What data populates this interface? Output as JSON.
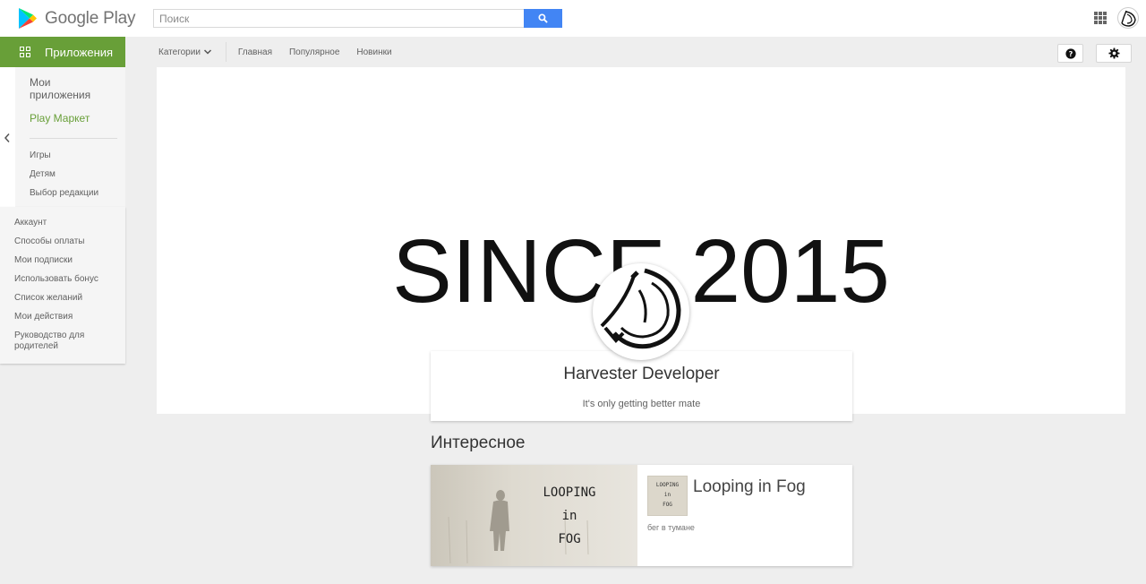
{
  "header": {
    "logo_text": "Google Play",
    "search_placeholder": "Поиск"
  },
  "subnav": {
    "apps_tab": "Приложения",
    "categories": "Категории",
    "links": [
      "Главная",
      "Популярное",
      "Новинки"
    ]
  },
  "sidebar": {
    "my_apps": "Мои приложения",
    "play_market": "Play Маркет",
    "sub_items": [
      "Игры",
      "Детям",
      "Выбор редакции"
    ],
    "account_links": [
      "Аккаунт",
      "Способы оплаты",
      "Мои подписки",
      "Использовать бонус",
      "Список желаний",
      "Мои действия",
      "Руководство для родителей"
    ]
  },
  "banner": {
    "title": "SINCE 2015"
  },
  "developer": {
    "name": "Harvester Developer",
    "tagline": "It's only getting better mate"
  },
  "featured": {
    "section_title": "Интересное",
    "image_text": [
      "LOOPING",
      "in",
      "FOG"
    ],
    "app_title": "Looping in Fog",
    "app_description": "бег в тумане"
  },
  "colors": {
    "apps_green": "#689f38",
    "search_blue": "#4285f4"
  }
}
